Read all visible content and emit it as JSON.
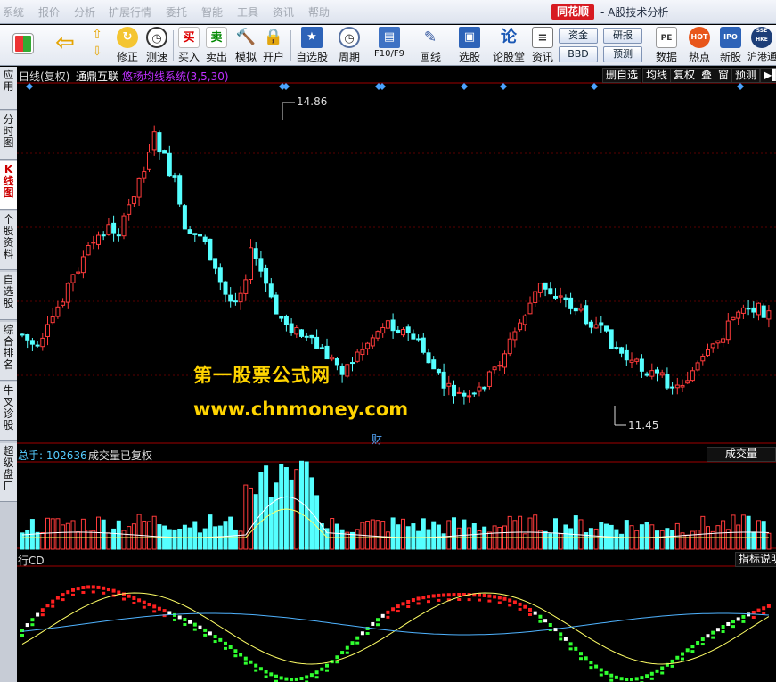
{
  "menu": [
    "系统",
    "报价",
    "分析",
    "扩展行情",
    "委托",
    "智能",
    "工具",
    "资讯",
    "帮助"
  ],
  "brand": "同花顺",
  "app_title": "- A股技术分析",
  "toolbar": [
    {
      "label": "修正",
      "icon": "refresh-icon"
    },
    {
      "label": "测速",
      "icon": "clock-icon"
    },
    {
      "label": "买入",
      "glyph": "买"
    },
    {
      "label": "卖出",
      "glyph": "卖"
    },
    {
      "label": "模拟",
      "icon": "hammer-icon"
    },
    {
      "label": "开户",
      "icon": "lock-icon"
    },
    {
      "label": "自选股",
      "icon": "star-icon"
    },
    {
      "label": "周期",
      "icon": "clock-icon"
    },
    {
      "label": "F10/F9",
      "icon": "table-icon"
    },
    {
      "label": "画线",
      "icon": "pencil-icon"
    },
    {
      "label": "选股",
      "icon": "screen-icon"
    },
    {
      "label": "论股堂",
      "glyph": "论"
    },
    {
      "label": "资讯",
      "icon": "doc-icon"
    },
    {
      "label": "数据",
      "glyph": "PE"
    },
    {
      "label": "热点",
      "glyph": "HOT"
    },
    {
      "label": "新股",
      "glyph": "IPO"
    },
    {
      "label": "沪港通",
      "glyph": "SSE HKE"
    }
  ],
  "small_buttons": [
    "资金",
    "研报",
    "BBD",
    "预测"
  ],
  "side_tabs": [
    "应用",
    "分时图",
    "K线图",
    "个股资料",
    "自选股",
    "综合排名",
    "牛叉诊股",
    "超级盘口"
  ],
  "kline": {
    "period": "日线(复权)",
    "stock": "通鼎互联",
    "indicator": "悠杨均线系统(3,5,30)",
    "high_label": "14.86",
    "low_label": "11.45",
    "finance_mark": "财"
  },
  "kline_tabs": [
    "删自选",
    "均线",
    "复权",
    "叠",
    "窗",
    "预测"
  ],
  "volume": {
    "label": "总手: 102636",
    "note": "成交量已复权",
    "tab": "成交量"
  },
  "macd": {
    "label": "行CD",
    "tab": "指标说明"
  },
  "watermark": {
    "line1": "第一股票公式网",
    "line2": "www.chnmoney.com"
  },
  "colors": {
    "up": "#ff3b3b",
    "down": "#55ffff",
    "bg": "#000000",
    "grid": "#7a0000",
    "yellow": "#ffff66"
  }
}
